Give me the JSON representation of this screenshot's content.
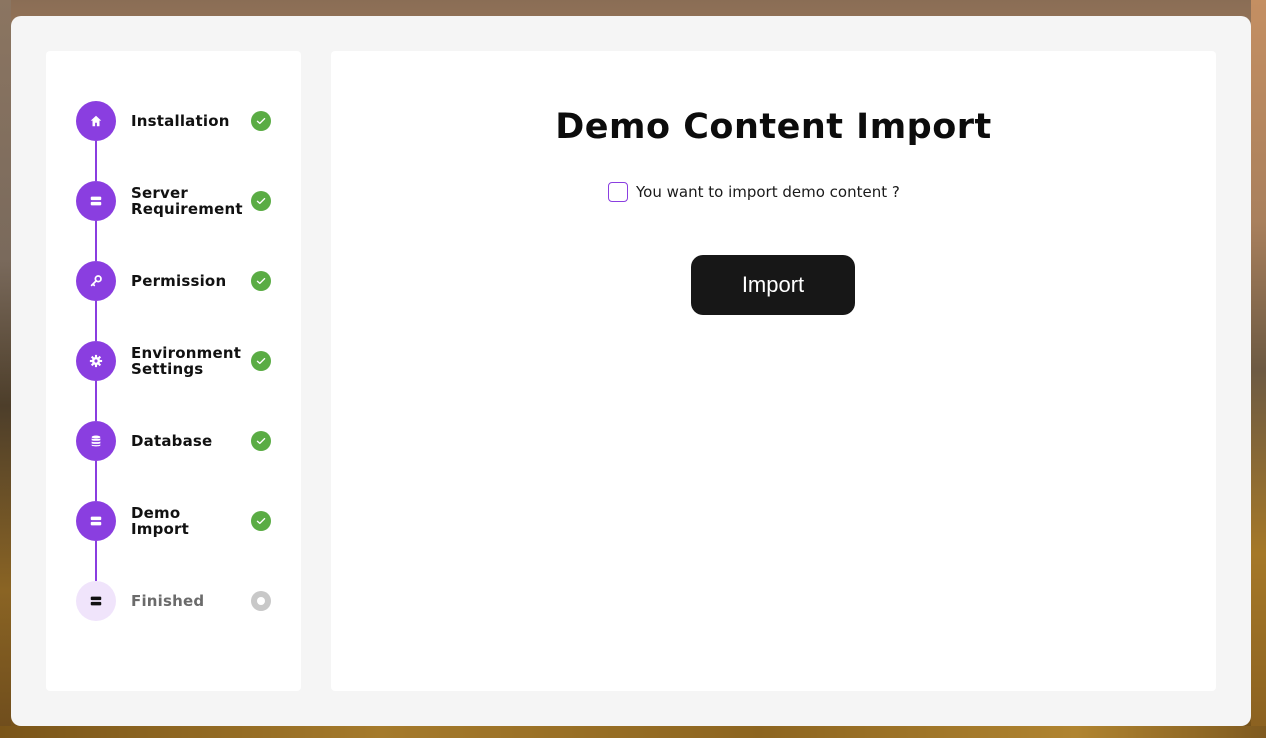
{
  "colors": {
    "accent": "#8a3ee0",
    "accent_light": "#f0e4fb",
    "done": "#5aac44",
    "pending": "#c8c8c8",
    "button": "#171717"
  },
  "steps": [
    {
      "label": "Installation",
      "icon": "home-icon",
      "status": "done"
    },
    {
      "label": "Server Requirement",
      "icon": "server-icon",
      "status": "done"
    },
    {
      "label": "Permission",
      "icon": "key-icon",
      "status": "done"
    },
    {
      "label": "Environment Settings",
      "icon": "gear-icon",
      "status": "done"
    },
    {
      "label": "Database",
      "icon": "database-icon",
      "status": "done"
    },
    {
      "label": "Demo Import",
      "icon": "server-icon",
      "status": "done"
    },
    {
      "label": "Finished",
      "icon": "server-icon",
      "status": "pending"
    }
  ],
  "main": {
    "title": "Demo Content Import",
    "checkbox_label": "You want to import demo content ?",
    "checkbox_checked": false,
    "import_button": "Import"
  }
}
